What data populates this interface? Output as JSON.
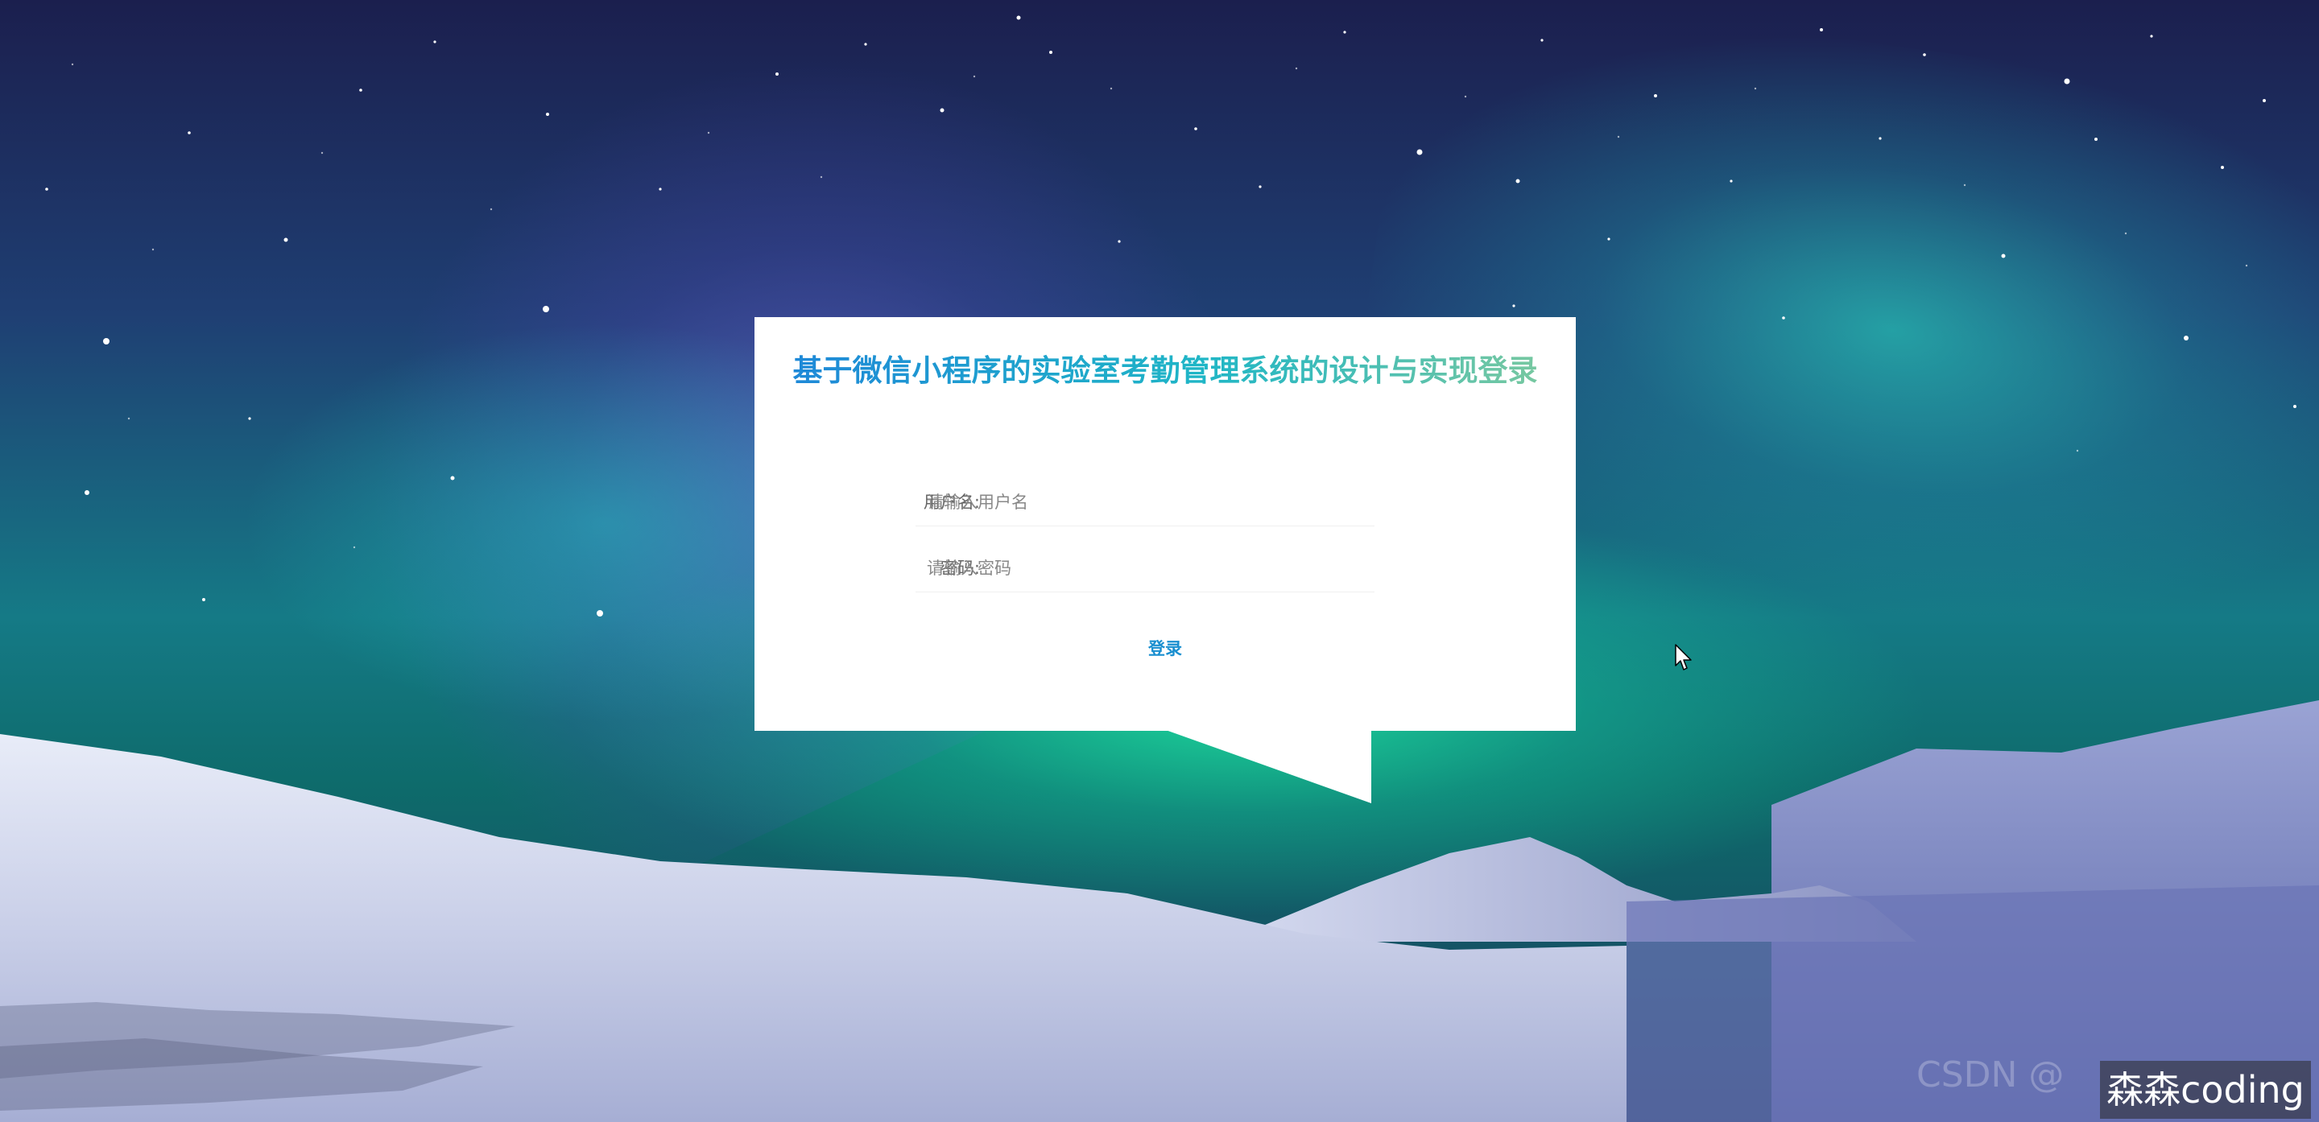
{
  "login": {
    "title": "基于微信小程序的实验室考勤管理系统的设计与实现登录",
    "username_label": "用户名:",
    "username_placeholder": "请输入用户名",
    "password_label": "密码:",
    "password_placeholder": "请输入密码",
    "submit_label": "登录"
  },
  "watermark": {
    "text": "森森coding",
    "faint_text": "CSDN @"
  },
  "colors": {
    "title_gradient_start": "#1e88d8",
    "title_gradient_end": "#78c8a0",
    "button_text": "#1a8fd0",
    "card_background": "#ffffff"
  },
  "icons": {
    "cursor": "mouse-pointer-icon"
  }
}
